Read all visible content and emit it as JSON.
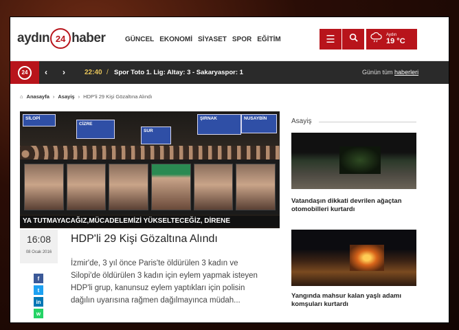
{
  "logo": {
    "left": "aydın",
    "badge": "24",
    "right": "haber"
  },
  "nav": [
    "GÜNCEL",
    "EKONOMİ",
    "SİYASET",
    "SPOR",
    "EĞİTİM"
  ],
  "header": {
    "menu_icon": "☰",
    "search_icon": "⌕"
  },
  "weather": {
    "icon": "cloud-rain-icon",
    "city": "Aydın",
    "temp": "19 °C"
  },
  "ticker": {
    "badge": "24",
    "prev": "‹",
    "next": "›",
    "time": "22:40",
    "separator": "/",
    "headline": "Spor Toto 1. Lig: Altay: 3 - Sakaryaspor: 1",
    "all_prefix": "Günün tüm",
    "all_link": "haberleri"
  },
  "breadcrumb": {
    "home": "Anasayfa",
    "section": "Asayiş",
    "current": "HDP'li 29 Kişi Gözaltına Alındı"
  },
  "hero": {
    "signs": [
      "ŞIRNAK",
      "CİZRE",
      "SUR",
      "SİLOPİ",
      "NUSAYBİN"
    ],
    "banner_text": "YA TUTMAYACAĞIZ,MÜCADELEMİZİ YÜKSELTECEĞİZ, DİRENE"
  },
  "article": {
    "time": "16:08",
    "date": "08 Ocak 2016",
    "title": "HDP'li 29 Kişi Gözaltına Alındı",
    "summary": "İzmir'de, 3 yıl önce Paris'te öldürülen 3 kadın ve Silopi'de öldürülen 3 kadın için eylem yapmak isteyen HDP'li grup, kanunsuz eylem yaptıkları için polisin dağılın uyarısına rağmen dağılmayınca müdah..."
  },
  "share": [
    {
      "label": "f",
      "color": "#3b5998"
    },
    {
      "label": "t",
      "color": "#1da1f2"
    },
    {
      "label": "in",
      "color": "#0077b5"
    },
    {
      "label": "w",
      "color": "#25d366"
    }
  ],
  "sidebar": {
    "title": "Asayiş",
    "items": [
      {
        "caption": "Vatandaşın dikkati devrilen ağaçtan otomobilleri kurtardı"
      },
      {
        "caption": "Yangında mahsur kalan yaşlı adamı komşuları kurtardı"
      }
    ]
  }
}
